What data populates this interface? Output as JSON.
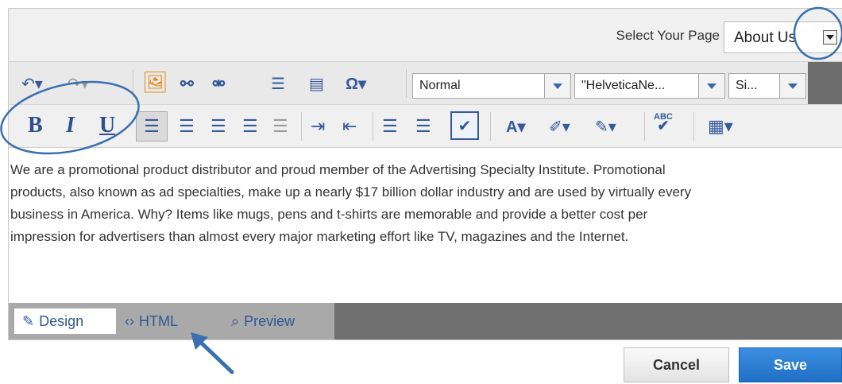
{
  "page_selector": {
    "label": "Select Your Page",
    "value": "About Us"
  },
  "toolbar": {
    "format_block": "Normal",
    "font_family": "\"HelveticaNe...",
    "font_size": "Si...",
    "bold": "B",
    "italic": "I",
    "underline": "U",
    "spell_check": "ABC"
  },
  "editor": {
    "content": "We are a promotional product distributor and proud member of the Advertising Specialty Institute. Promotional products, also known as ad specialties, make up a nearly $17 billion dollar industry and are used by virtually every business in America. Why? Items like mugs, pens and t-shirts are memorable and provide a better cost per impression for advertisers than almost every major marketing effort like TV, magazines and the Internet."
  },
  "tabs": [
    {
      "label": "Design",
      "active": true
    },
    {
      "label": "HTML",
      "active": false
    },
    {
      "label": "Preview",
      "active": false
    }
  ],
  "buttons": {
    "cancel": "Cancel",
    "save": "Save"
  },
  "colors": {
    "accent": "#2a73c9",
    "annotation": "#3a6fb0",
    "toolbar_icon": "#355a9a"
  }
}
